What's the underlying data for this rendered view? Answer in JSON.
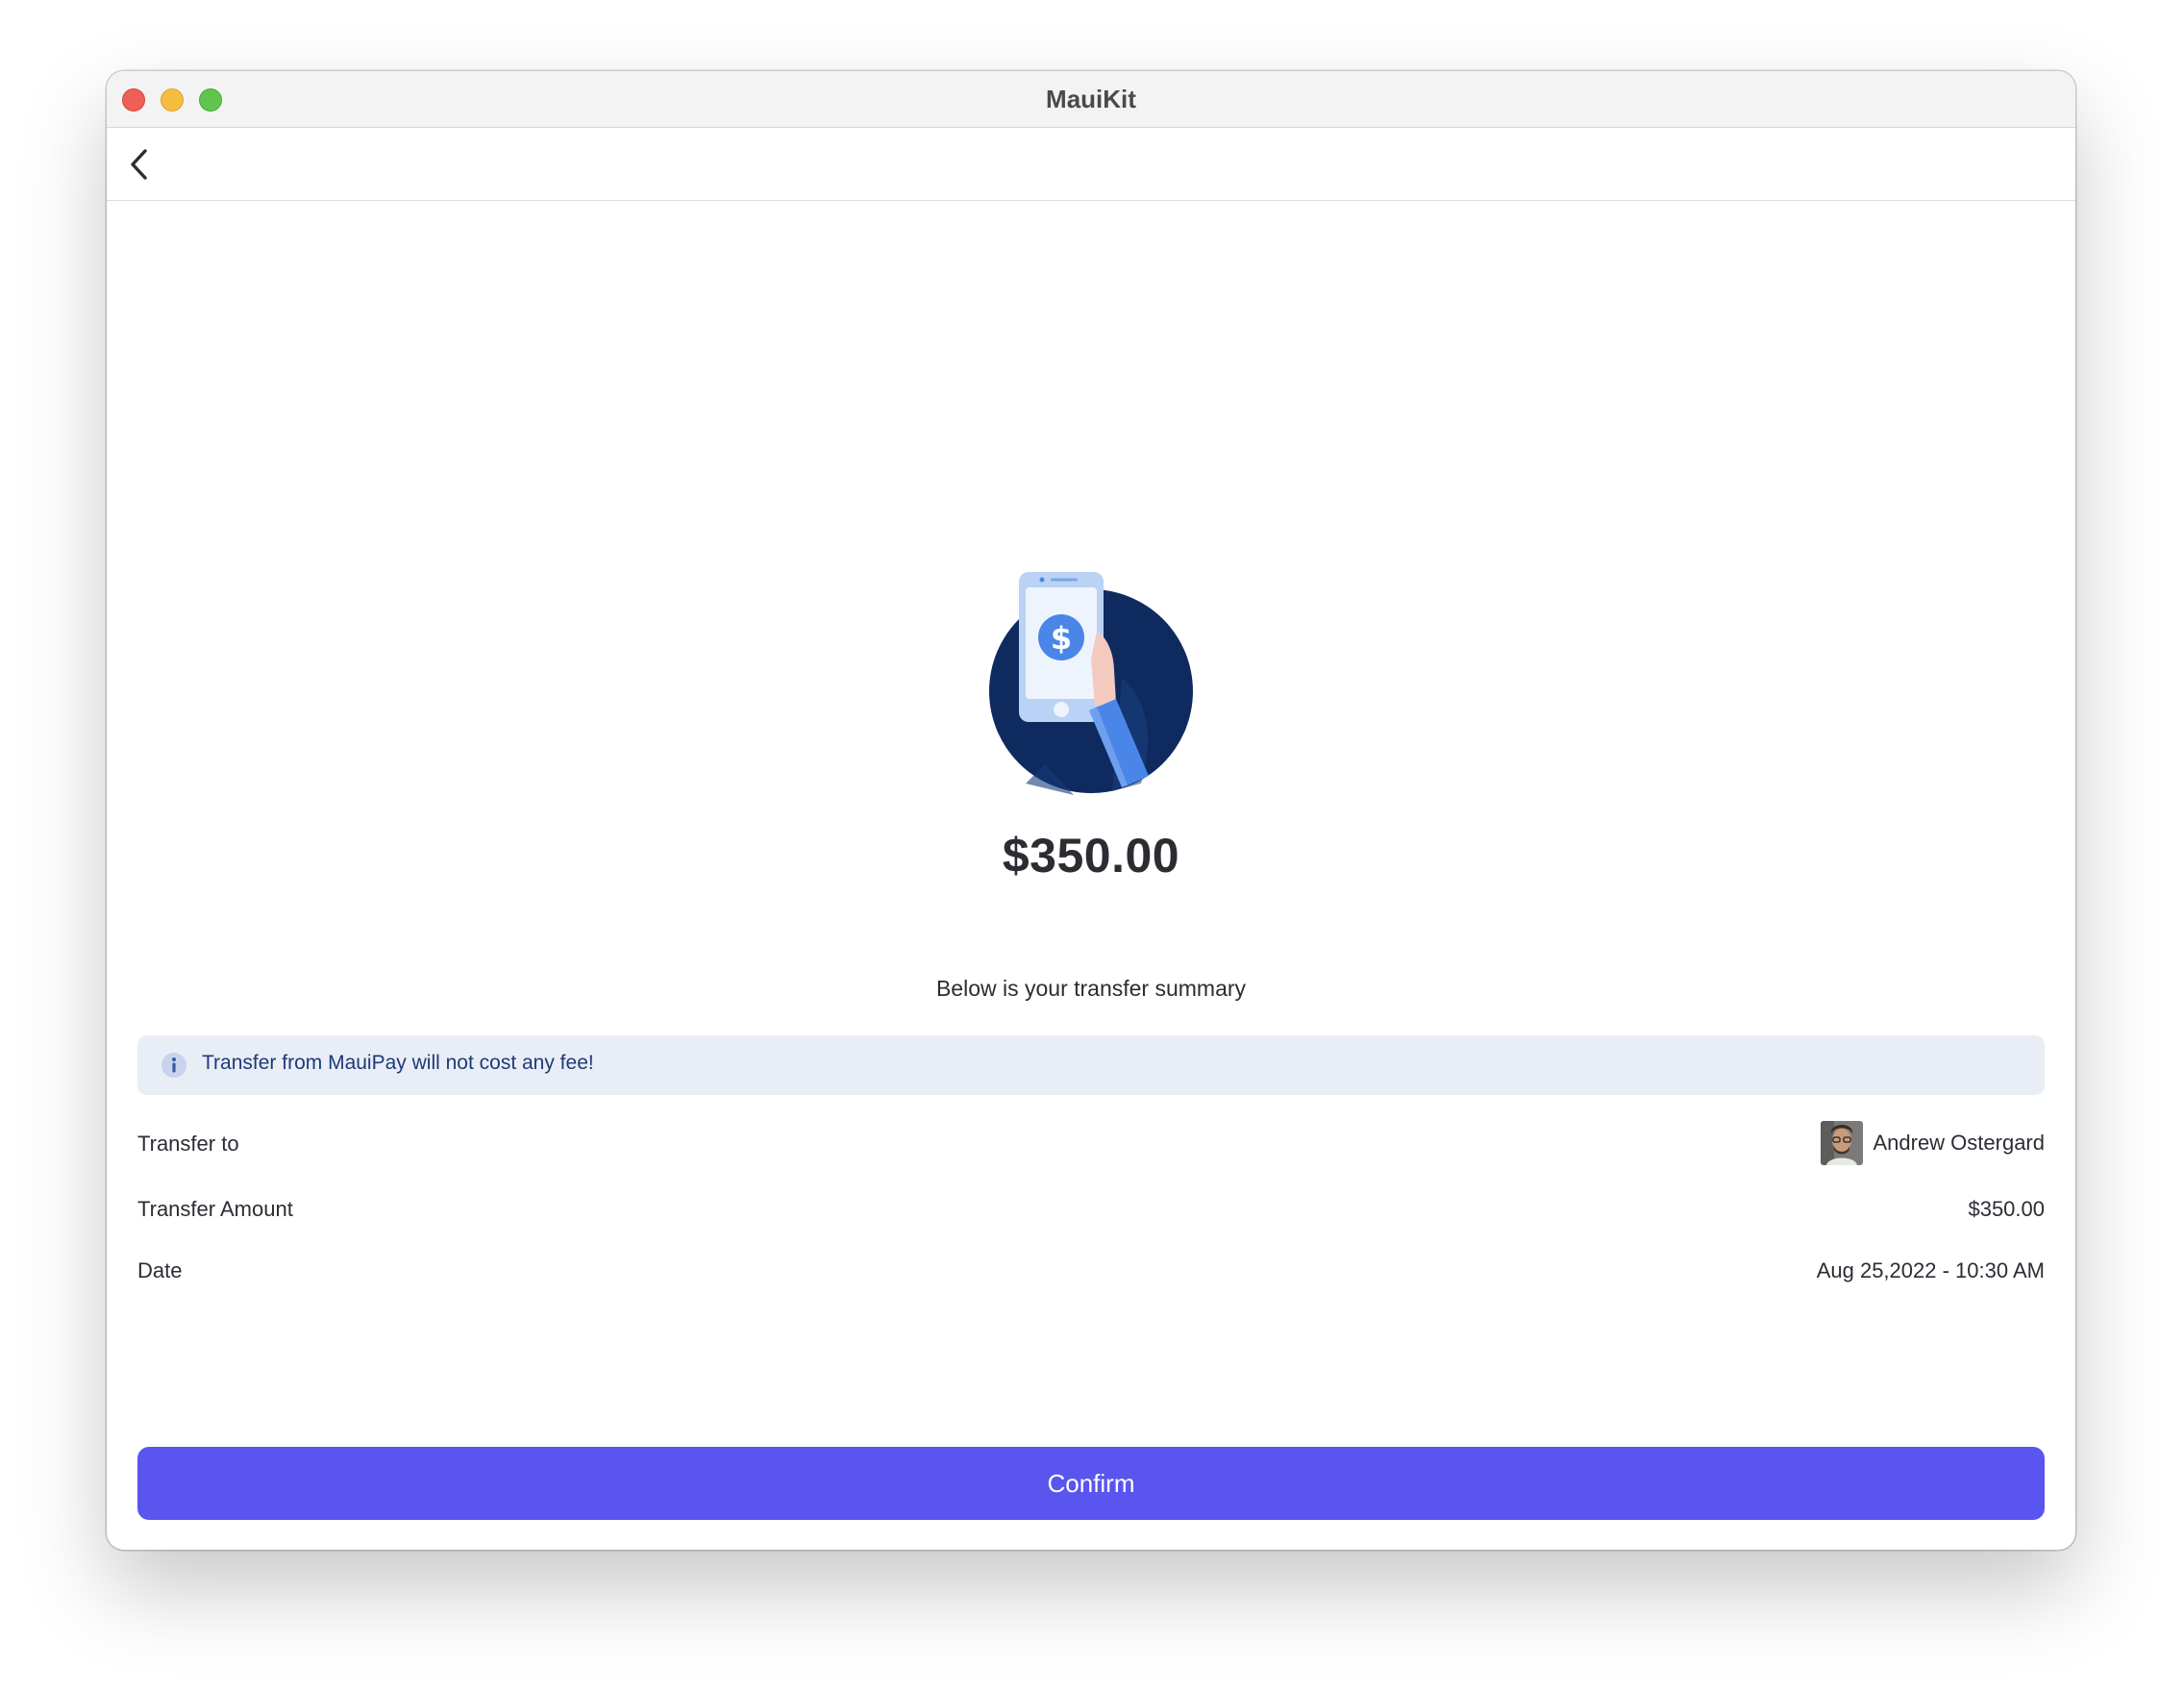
{
  "window": {
    "title": "MauiKit"
  },
  "navbar": {
    "back_icon": "chevron-left-icon"
  },
  "summary": {
    "amount": "$350.00",
    "subtitle": "Below is your transfer summary",
    "illustration": "phone-payment-illustration"
  },
  "info_banner": {
    "icon": "info-icon",
    "text": "Transfer from MauiPay will not cost any fee!"
  },
  "details": {
    "transfer_to_label": "Transfer to",
    "recipient_name": "Andrew Ostergard",
    "transfer_amount_label": "Transfer Amount",
    "transfer_amount_value": "$350.00",
    "date_label": "Date",
    "date_value": "Aug 25,2022 - 10:30 AM"
  },
  "actions": {
    "confirm_label": "Confirm"
  },
  "colors": {
    "accent": "#5955ee",
    "banner_bg": "#e9edf6",
    "banner_text": "#1d3b78",
    "illustration_navy": "#0f2a5e",
    "illustration_blue": "#4a86e8"
  }
}
